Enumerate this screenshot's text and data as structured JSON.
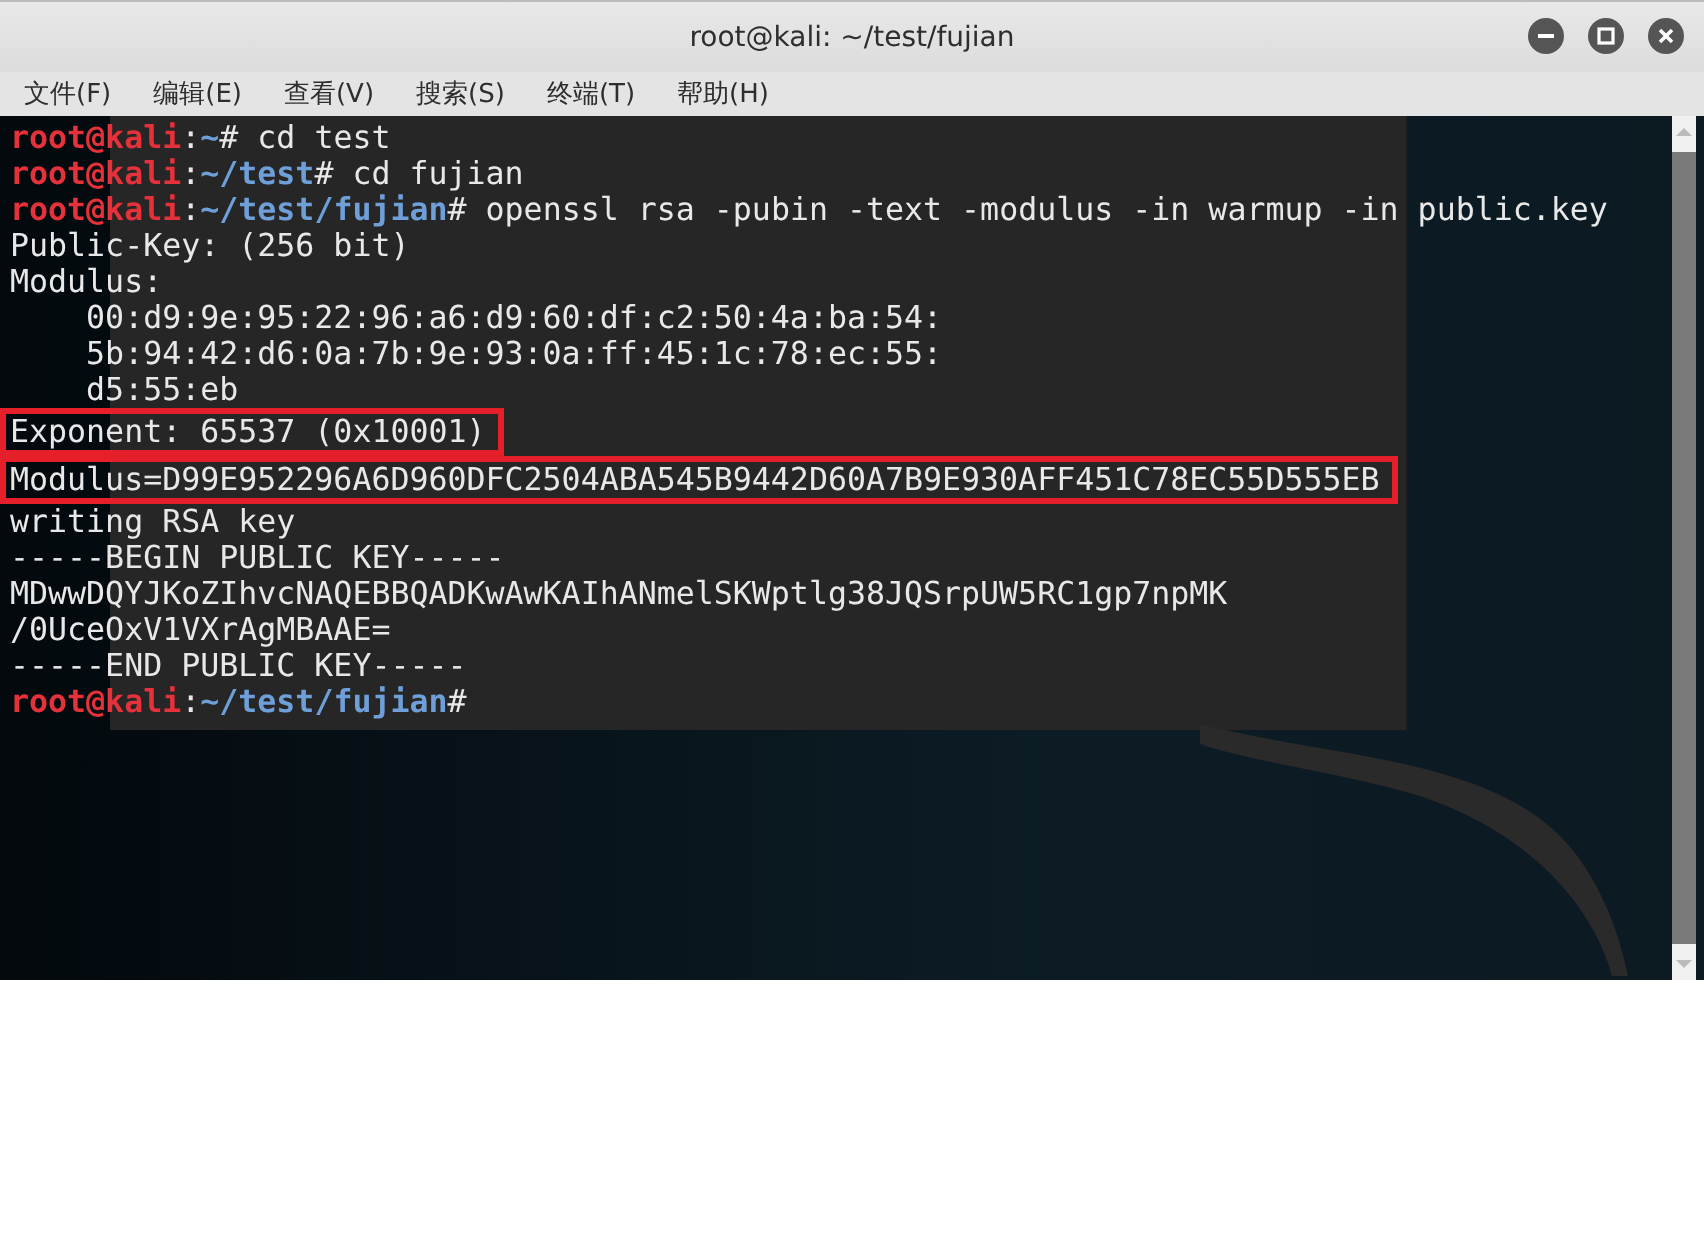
{
  "window": {
    "title": "root@kali: ~/test/fujian"
  },
  "menu": [
    {
      "label": "文件(F)"
    },
    {
      "label": "编辑(E)"
    },
    {
      "label": "查看(V)"
    },
    {
      "label": "搜索(S)"
    },
    {
      "label": "终端(T)"
    },
    {
      "label": "帮助(H)"
    }
  ],
  "terminal": {
    "lines": [
      {
        "highlighted": false,
        "segments": [
          {
            "kind": "user",
            "text": "root@kali"
          },
          {
            "kind": "plain",
            "text": ":"
          },
          {
            "kind": "path",
            "text": "~"
          },
          {
            "kind": "plain",
            "text": "# cd test"
          }
        ]
      },
      {
        "highlighted": false,
        "segments": [
          {
            "kind": "user",
            "text": "root@kali"
          },
          {
            "kind": "plain",
            "text": ":"
          },
          {
            "kind": "path",
            "text": "~/test"
          },
          {
            "kind": "plain",
            "text": "# cd fujian"
          }
        ]
      },
      {
        "highlighted": false,
        "segments": [
          {
            "kind": "user",
            "text": "root@kali"
          },
          {
            "kind": "plain",
            "text": ":"
          },
          {
            "kind": "path",
            "text": "~/test/fujian"
          },
          {
            "kind": "plain",
            "text": "# openssl rsa -pubin -text -modulus -in warmup -in public.key"
          }
        ]
      },
      {
        "highlighted": false,
        "segments": [
          {
            "kind": "plain",
            "text": "Public-Key: (256 bit)"
          }
        ]
      },
      {
        "highlighted": false,
        "segments": [
          {
            "kind": "plain",
            "text": "Modulus:"
          }
        ]
      },
      {
        "highlighted": false,
        "segments": [
          {
            "kind": "plain",
            "text": "    00:d9:9e:95:22:96:a6:d9:60:df:c2:50:4a:ba:54:"
          }
        ]
      },
      {
        "highlighted": false,
        "segments": [
          {
            "kind": "plain",
            "text": "    5b:94:42:d6:0a:7b:9e:93:0a:ff:45:1c:78:ec:55:"
          }
        ]
      },
      {
        "highlighted": false,
        "segments": [
          {
            "kind": "plain",
            "text": "    d5:55:eb"
          }
        ]
      },
      {
        "highlighted": true,
        "segments": [
          {
            "kind": "plain",
            "text": "Exponent: 65537 (0x10001)"
          }
        ]
      },
      {
        "highlighted": true,
        "segments": [
          {
            "kind": "plain",
            "text": "Modulus=D99E952296A6D960DFC2504ABA545B9442D60A7B9E930AFF451C78EC55D555EB"
          }
        ]
      },
      {
        "highlighted": false,
        "segments": [
          {
            "kind": "plain",
            "text": "writing RSA key"
          }
        ]
      },
      {
        "highlighted": false,
        "segments": [
          {
            "kind": "plain",
            "text": "-----BEGIN PUBLIC KEY-----"
          }
        ]
      },
      {
        "highlighted": false,
        "segments": [
          {
            "kind": "plain",
            "text": "MDwwDQYJKoZIhvcNAQEBBQADKwAwKAIhANmelSKWptlg38JQSrpUW5RC1gp7npMK"
          }
        ]
      },
      {
        "highlighted": false,
        "segments": [
          {
            "kind": "plain",
            "text": "/0UceOxV1VXrAgMBAAE="
          }
        ]
      },
      {
        "highlighted": false,
        "segments": [
          {
            "kind": "plain",
            "text": "-----END PUBLIC KEY-----"
          }
        ]
      },
      {
        "highlighted": false,
        "segments": [
          {
            "kind": "user",
            "text": "root@kali"
          },
          {
            "kind": "plain",
            "text": ":"
          },
          {
            "kind": "path",
            "text": "~/test/fujian"
          },
          {
            "kind": "plain",
            "text": "#"
          }
        ]
      }
    ]
  }
}
